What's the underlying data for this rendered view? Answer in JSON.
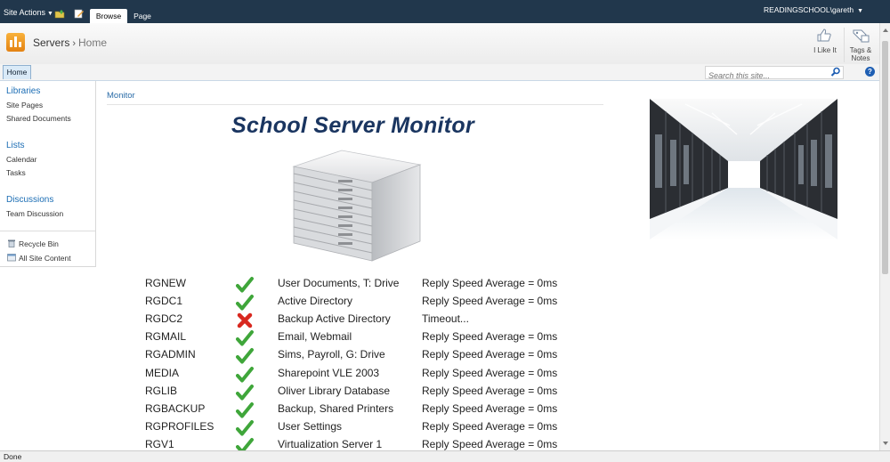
{
  "ribbon": {
    "site_actions": "Site Actions",
    "tabs": [
      {
        "label": "Browse"
      },
      {
        "label": "Page"
      }
    ],
    "user": "READINGSCHOOL\\gareth",
    "like_label": "I Like It",
    "tags_label_1": "Tags &",
    "tags_label_2": "Notes"
  },
  "breadcrumb": {
    "site": "Servers",
    "page": "Home"
  },
  "topnav": {
    "home": "Home",
    "search_placeholder": "Search this site..."
  },
  "quicklaunch": {
    "libraries": "Libraries",
    "site_pages": "Site Pages",
    "shared_documents": "Shared Documents",
    "lists": "Lists",
    "calendar": "Calendar",
    "tasks": "Tasks",
    "discussions": "Discussions",
    "team_discussion": "Team Discussion",
    "recycle_bin": "Recycle Bin",
    "all_site_content": "All Site Content"
  },
  "main": {
    "section_title": "Monitor",
    "heading": "School Server Monitor",
    "servers": [
      {
        "name": "RGNEW",
        "status_icon": "check-icon",
        "ok": true,
        "description": "User Documents, T: Drive",
        "status": "Reply Speed Average = 0ms"
      },
      {
        "name": "RGDC1",
        "status_icon": "check-icon",
        "ok": true,
        "description": "Active Directory",
        "status": "Reply Speed Average = 0ms"
      },
      {
        "name": "RGDC2",
        "status_icon": "cross-icon",
        "ok": false,
        "description": "Backup Active Directory",
        "status": "Timeout..."
      },
      {
        "name": "RGMAIL",
        "status_icon": "check-icon",
        "ok": true,
        "description": "Email, Webmail",
        "status": "Reply Speed Average = 0ms"
      },
      {
        "name": "RGADMIN",
        "status_icon": "check-icon",
        "ok": true,
        "description": "Sims, Payroll, G: Drive",
        "status": "Reply Speed Average = 0ms"
      },
      {
        "name": "MEDIA",
        "status_icon": "check-icon",
        "ok": true,
        "description": "Sharepoint VLE 2003",
        "status": "Reply Speed Average = 0ms"
      },
      {
        "name": "RGLIB",
        "status_icon": "check-icon",
        "ok": true,
        "description": "Oliver Library Database",
        "status": "Reply Speed Average = 0ms"
      },
      {
        "name": "RGBACKUP",
        "status_icon": "check-icon",
        "ok": true,
        "description": "Backup, Shared Printers",
        "status": "Reply Speed Average = 0ms"
      },
      {
        "name": "RGPROFILES",
        "status_icon": "check-icon",
        "ok": true,
        "description": "User Settings",
        "status": "Reply Speed Average = 0ms"
      },
      {
        "name": "RGV1",
        "status_icon": "check-icon",
        "ok": true,
        "description": "Virtualization Server 1",
        "status": "Reply Speed Average = 0ms"
      }
    ]
  },
  "statusbar": {
    "text": "Done"
  },
  "colors": {
    "ribbon_bg": "#21374c",
    "link": "#1b6db4",
    "heading": "#1a3560",
    "ok": "#3fa63a",
    "fail": "#d8281f"
  }
}
